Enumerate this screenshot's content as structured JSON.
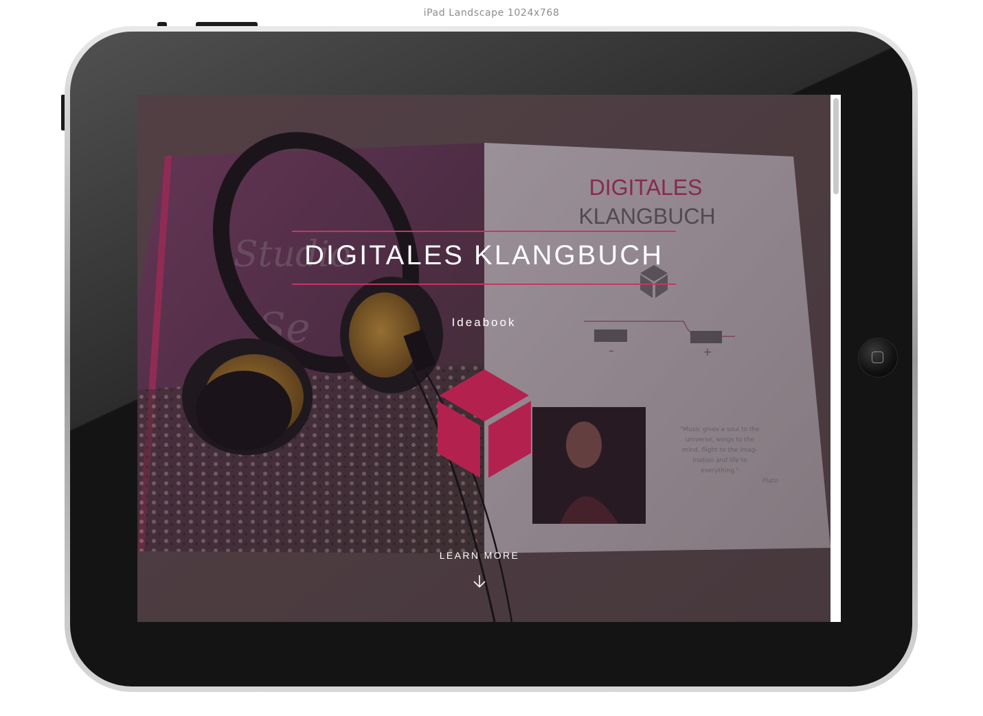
{
  "device": {
    "label": "iPad Landscape 1024x768"
  },
  "hero": {
    "title": "DIGITALES KLANGBUCH",
    "subtitle": "Ideabook",
    "cta": "LEARN MORE"
  },
  "colors": {
    "accent": "#b3224f",
    "rule": "#c43762",
    "text": "#ffffff",
    "device_frame": "#141414"
  },
  "icons": {
    "logo": "cube-icon",
    "cta": "arrow-down-icon",
    "device": "home-button-icon"
  }
}
